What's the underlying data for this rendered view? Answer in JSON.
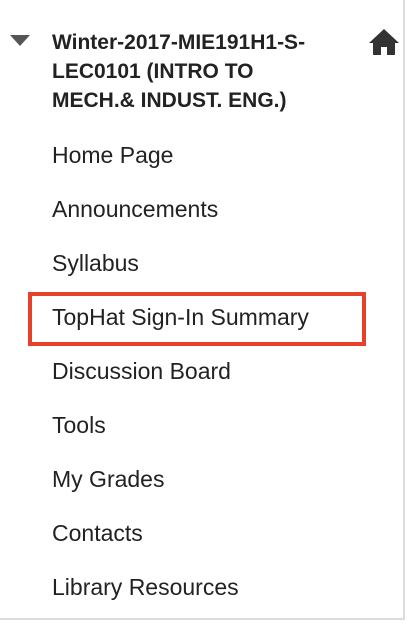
{
  "course": {
    "title_lines": [
      "Winter-2017-MIE191H1-S-",
      "LEC0101 (INTRO TO",
      "MECH.& INDUST. ENG.)"
    ],
    "collapse_icon": "caret-down-icon",
    "home_icon": "home-icon"
  },
  "menu": {
    "items": [
      {
        "label": "Home Page"
      },
      {
        "label": "Announcements"
      },
      {
        "label": "Syllabus"
      },
      {
        "label": "TopHat Sign-In Summary",
        "highlighted": true
      },
      {
        "label": "Discussion Board"
      },
      {
        "label": "Tools"
      },
      {
        "label": "My Grades"
      },
      {
        "label": "Contacts"
      },
      {
        "label": "Library Resources"
      }
    ]
  },
  "colors": {
    "text": "#222222",
    "highlight_border": "#e8412b",
    "icon": "#444444",
    "panel_border": "#dcdcdc"
  }
}
